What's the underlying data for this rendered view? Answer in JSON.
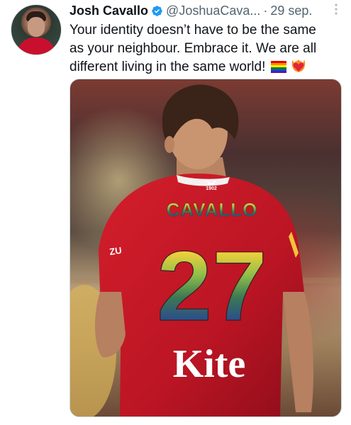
{
  "tweet": {
    "author_name": "Josh Cavallo",
    "handle": "@JoshuaCava...",
    "separator": "·",
    "date": "29 sep.",
    "text_line1": "Your identity doesn’t have to be the same",
    "text_line2": "as your neighbour. Embrace it. We are all",
    "text_line3": "different living in the same world!",
    "emojis": [
      "rainbow-flag-icon",
      "heart-on-fire-icon"
    ]
  },
  "photo": {
    "jersey_name": "CAVALLO",
    "jersey_number": "27",
    "sponsor": "Kite",
    "sleeve_text": "ZU",
    "crest_text": "1902"
  },
  "colors": {
    "verified_blue": "#1d9bf0",
    "handle_gray": "#536471",
    "jersey_red": "#c8102e"
  }
}
